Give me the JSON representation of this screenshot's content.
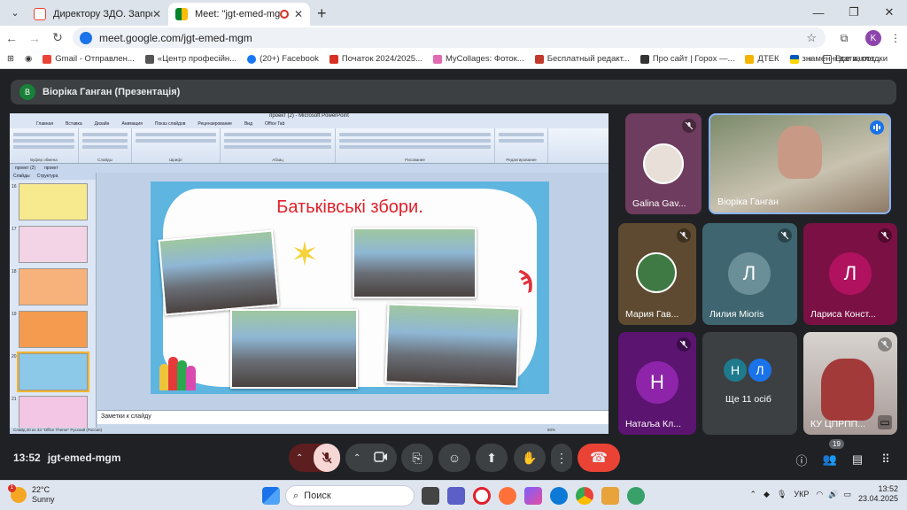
{
  "browser": {
    "tabs": [
      {
        "title": "Директору ЗДО. Запрошення",
        "active": false
      },
      {
        "title": "Meet: \"jgt-emed-mgm\"",
        "active": true
      }
    ],
    "url": "meet.google.com/jgt-emed-mgm",
    "profile_initial": "K",
    "bookmarks": [
      {
        "label": "Gmail - Отправлен...",
        "color": "#ea4335"
      },
      {
        "label": "«Центр професійн...",
        "color": "#555555"
      },
      {
        "label": "(20+) Facebook",
        "color": "#1877f2"
      },
      {
        "label": "Початок 2024/2025...",
        "color": "#d93025"
      },
      {
        "label": "MyCollages: Фоток...",
        "color": "#e06bb0"
      },
      {
        "label": "Бесплатный редакт...",
        "color": "#c0392b"
      },
      {
        "label": "Про сайт | Горох —...",
        "color": "#333333"
      },
      {
        "label": "ДТЕК",
        "color": "#f4b400"
      },
      {
        "label": "знаменні дати, пот...",
        "color": "#0057b7"
      }
    ],
    "bookmarks_more": "»",
    "all_bookmarks": "Все закладки"
  },
  "meet": {
    "presenter_initial": "В",
    "presenter_banner": "Віоріка Ганган (Презентація)",
    "ppt": {
      "window_title": "проект (2) - Microsoft PowerPoint",
      "ribbon_tabs": [
        "Главная",
        "Вставка",
        "Дизайн",
        "Анимация",
        "Показ слайдов",
        "Рецензирование",
        "Вид",
        "Office Tab"
      ],
      "ribbon_groups": [
        "Буфер обмена",
        "Слайды",
        "Шрифт",
        "Абзац",
        "Рисование",
        "Редактирование"
      ],
      "doc_tabs": [
        "проект (2)",
        "проект"
      ],
      "panel_tabs": [
        "Слайды",
        "Структура"
      ],
      "slide_title": "Батьківські збори.",
      "notes_placeholder": "Заметки к слайду",
      "status": "Слайд 20 из 33    \"Office Theme\"    Русский (Россия)",
      "zoom": "60%"
    },
    "participants": [
      {
        "name": "Galina Gav...",
        "muted": true
      },
      {
        "name": "Віоріка Ганган",
        "muted": false
      },
      {
        "name": "Мария Гав...",
        "muted": true
      },
      {
        "name": "Лилия Mioris",
        "initial": "Л",
        "muted": true,
        "color": "#5a8a99"
      },
      {
        "name": "Лариса Конст...",
        "initial": "Л",
        "muted": true,
        "color": "#b0125f"
      },
      {
        "name": "Натаља Кл...",
        "initial": "Н",
        "muted": true,
        "color": "#8e24aa"
      },
      {
        "name": "Ще 11 осіб",
        "initials": [
          "Н",
          "Л"
        ]
      },
      {
        "name": "КУ ЦПРПП...",
        "muted": true
      }
    ],
    "time": "13:52",
    "meeting_code": "jgt-emed-mgm",
    "people_count": "19"
  },
  "taskbar": {
    "temp": "22°C",
    "weather": "Sunny",
    "alert_count": "1",
    "search_placeholder": "Поиск",
    "lang": "УКР",
    "time": "13:52",
    "date": "23.04.2025"
  }
}
